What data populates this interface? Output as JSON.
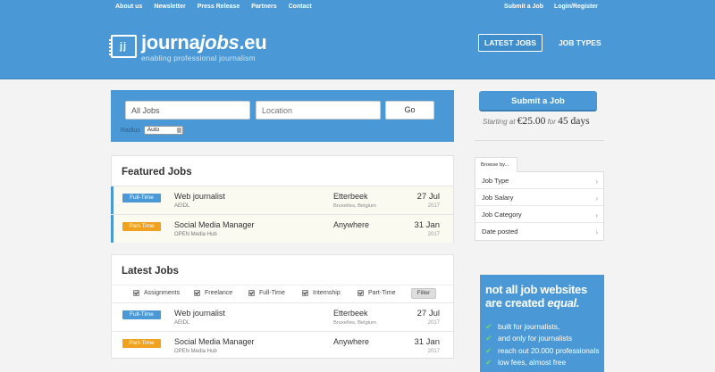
{
  "top_nav": [
    "About us",
    "Newsletter",
    "Press Release",
    "Partners",
    "Contact"
  ],
  "top_right": [
    "Submit a Job",
    "Login/Register"
  ],
  "logo": {
    "pre": "journa",
    "mid": "jobs",
    "post": ".eu",
    "mark": "jj",
    "tagline": "enabling professional journalism"
  },
  "main_nav": {
    "latest": "LATEST JOBS",
    "types": "JOB TYPES"
  },
  "search": {
    "jobs_value": "All Jobs",
    "location_placeholder": "Location",
    "go": "Go",
    "radius_label": "Radius",
    "radius_value": "Auto"
  },
  "featured": {
    "title": "Featured Jobs",
    "jobs": [
      {
        "type": "Full-Time",
        "title": "Web journalist",
        "company": "AEIDL",
        "location": "Etterbeek",
        "location_sub": "Bruxelles, Belgium",
        "date": "27 Jul",
        "year": "2017"
      },
      {
        "type": "Part-Time",
        "title": "Social Media Manager",
        "company": "OPEN Media Hub",
        "location": "Anywhere",
        "location_sub": "",
        "date": "31 Jan",
        "year": "2017"
      }
    ]
  },
  "latest": {
    "title": "Latest Jobs",
    "filters": [
      "Assignments",
      "Freelance",
      "Full-Time",
      "Internship",
      "Part-Time"
    ],
    "filter_button": "Filter",
    "jobs": [
      {
        "type": "Full-Time",
        "title": "Web journalist",
        "company": "AEIDL",
        "location": "Etterbeek",
        "location_sub": "Bruxelles, Belgium",
        "date": "27 Jul",
        "year": "2017"
      },
      {
        "type": "Part-Time",
        "title": "Social Media Manager",
        "company": "OPEN Media Hub",
        "location": "Anywhere",
        "location_sub": "",
        "date": "31 Jan",
        "year": "2017"
      }
    ]
  },
  "sidebar": {
    "submit": "Submit a Job",
    "price_prefix": "Starting at",
    "price_amount": "€25.00",
    "price_for": "for",
    "price_days": "45 days",
    "browse_tab": "Browse by...",
    "browse_items": [
      "Job Type",
      "Job Salary",
      "Job Category",
      "Date posted"
    ],
    "promo_line1": "not all job websites",
    "promo_line2a": "are created",
    "promo_line2b": "equal.",
    "promo_points": [
      "built for journalists,",
      "and only for journalists",
      "reach out 20.000 professionals",
      "low fees, almost free"
    ]
  },
  "colors": {
    "brand": "#4a99d6",
    "part_time": "#f0a11d",
    "check": "#6ed36f"
  }
}
